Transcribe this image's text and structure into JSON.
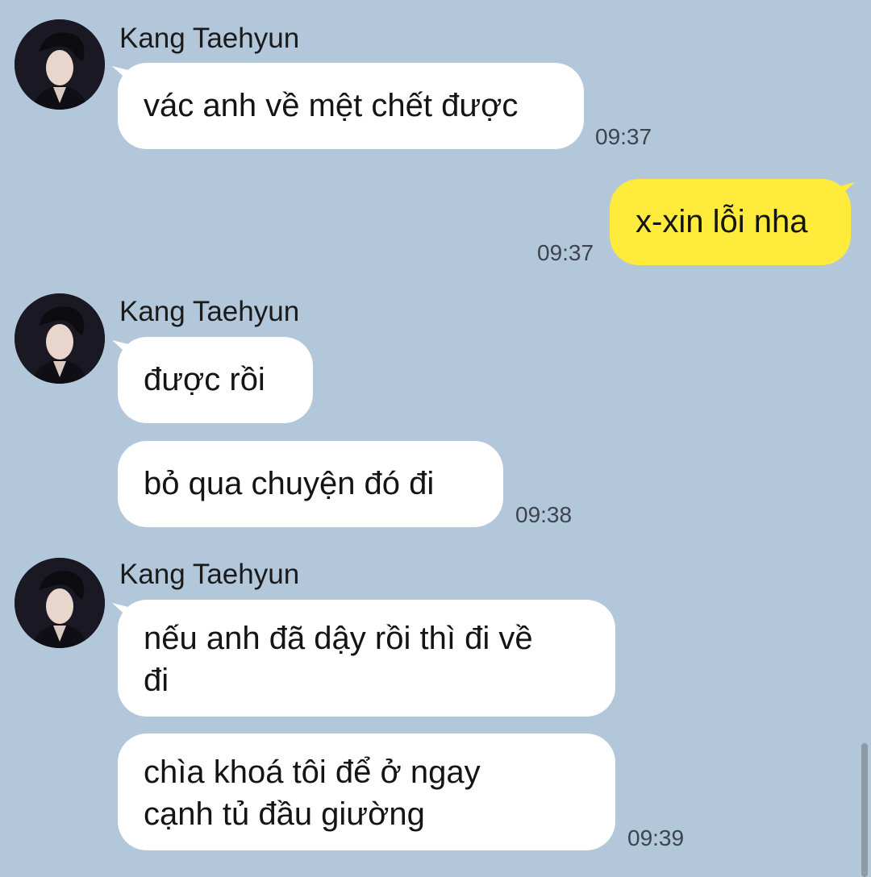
{
  "chat": {
    "contact_name": "Kang Taehyun",
    "messages": [
      {
        "from": "Kang Taehyun",
        "text": "vác anh về mệt chết được",
        "time": "09:37"
      },
      {
        "from": "me",
        "text": "x-xin lỗi nha",
        "time": "09:37"
      },
      {
        "from": "Kang Taehyun",
        "text": "được rồi"
      },
      {
        "from": "Kang Taehyun",
        "text": "bỏ qua chuyện đó đi",
        "time": "09:38"
      },
      {
        "from": "Kang Taehyun",
        "text": "nếu anh đã dậy rồi thì đi về\nđi"
      },
      {
        "from": "Kang Taehyun",
        "text": "chìa khoá tôi để ở ngay\ncạnh tủ đầu giường",
        "time": "09:39"
      }
    ]
  },
  "colors": {
    "background": "#b2c7da",
    "incoming_bubble": "#ffffff",
    "outgoing_bubble": "#ffeb3b"
  }
}
